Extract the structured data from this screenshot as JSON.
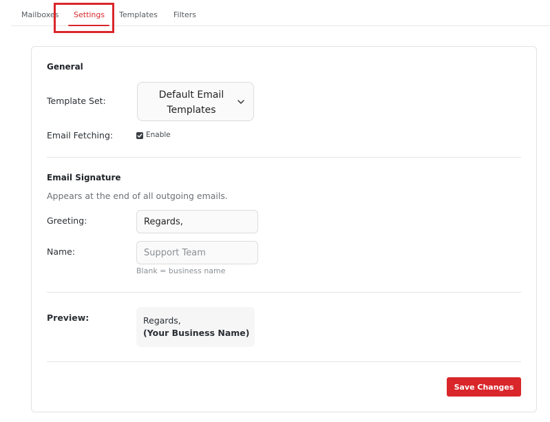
{
  "tabs": [
    {
      "label": "Mailboxes",
      "active": false
    },
    {
      "label": "Settings",
      "active": true
    },
    {
      "label": "Templates",
      "active": false
    },
    {
      "label": "Filters",
      "active": false
    }
  ],
  "general": {
    "title": "General",
    "template_set_label": "Template Set:",
    "template_set_value": "Default Email Templates",
    "email_fetching_label": "Email Fetching:",
    "email_fetching_checkbox_label": "Enable",
    "email_fetching_checked": true
  },
  "signature": {
    "title": "Email Signature",
    "description": "Appears at the end of all outgoing emails.",
    "greeting_label": "Greeting:",
    "greeting_value": "Regards,",
    "name_label": "Name:",
    "name_value": "",
    "name_placeholder": "Support Team",
    "name_hint": "Blank = business name"
  },
  "preview": {
    "label": "Preview:",
    "line1": "Regards,",
    "line2": "(Your Business Name)"
  },
  "actions": {
    "save_label": "Save Changes"
  },
  "colors": {
    "accent": "#d9262b",
    "border": "#e2e2e2"
  },
  "icons": {
    "select_chevron": "chevron-down-icon",
    "checkbox_check": "check-icon"
  }
}
